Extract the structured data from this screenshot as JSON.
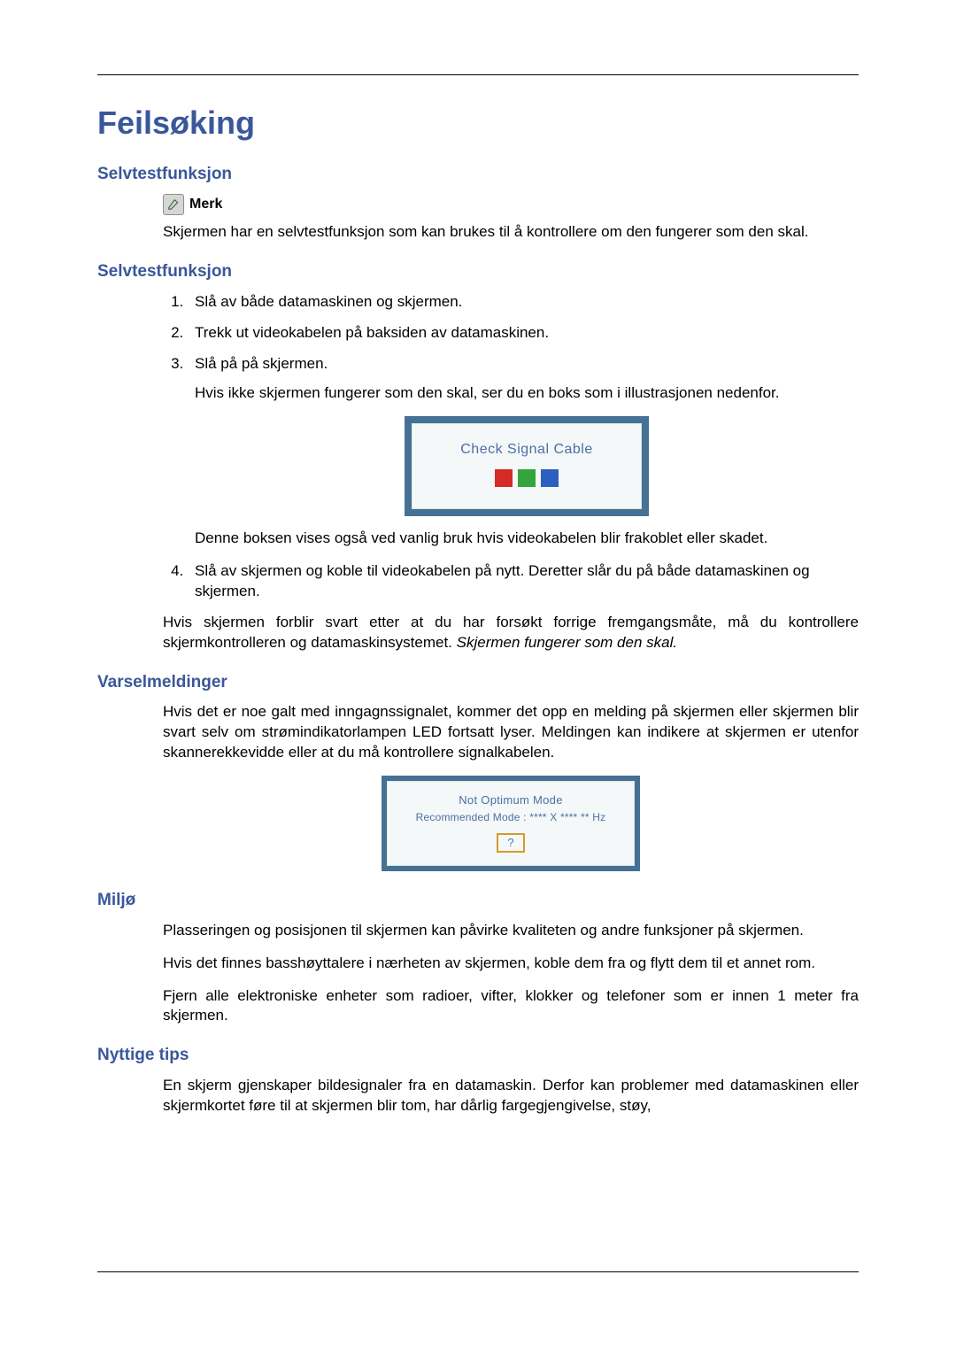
{
  "title": "Feilsøking",
  "sections": {
    "s1": {
      "heading": "Selvtestfunksjon",
      "note_label": "Merk",
      "para": "Skjermen har en selvtestfunksjon som kan brukes til å kontrollere om den fungerer som den skal."
    },
    "s2": {
      "heading": "Selvtestfunksjon",
      "steps": [
        "Slå av både datamaskinen og skjermen.",
        "Trekk ut videokabelen på baksiden av datamaskinen.",
        "Slå på på skjermen.",
        "Slå av skjermen og koble til videokabelen på nytt. Deretter slår du på både datamaskinen og skjermen."
      ],
      "step3_extra_before": "Hvis ikke skjermen fungerer som den skal, ser du en boks som i illustrasjonen nedenfor.",
      "step3_extra_after": "Denne boksen vises også ved vanlig bruk hvis videokabelen blir frakoblet eller skadet.",
      "osd_check_label": "Check Signal Cable",
      "closing_para": "Hvis skjermen forblir svart etter at du har forsøkt forrige fremgangsmåte, må du kontrollere skjermkontrolleren og datamaskinsystemet. ",
      "closing_italic": "Skjermen fungerer som den skal."
    },
    "s3": {
      "heading": "Varselmeldinger",
      "para": "Hvis det er noe galt med inngagnssignalet, kommer det opp en melding på skjermen eller skjermen blir svart selv om strømindikatorlampen LED fortsatt lyser. Meldingen kan indikere at skjermen er utenfor skannerekkevidde eller at du må kontrollere signalkabelen.",
      "osd_line1": "Not Optimum Mode",
      "osd_line2": "Recommended Mode : **** X **** ** Hz",
      "osd_q": "?"
    },
    "s4": {
      "heading": "Miljø",
      "p1": "Plasseringen og posisjonen til skjermen kan påvirke kvaliteten og andre funksjoner på skjermen.",
      "p2": "Hvis det finnes basshøyttalere i nærheten av skjermen, koble dem fra og flytt dem til et annet rom.",
      "p3": "Fjern alle elektroniske enheter som radioer, vifter, klokker og telefoner som er innen 1 meter fra skjermen."
    },
    "s5": {
      "heading": "Nyttige tips",
      "p1": "En skjerm gjenskaper bildesignaler fra en datamaskin. Derfor kan problemer med datamaskinen eller skjermkortet føre til at skjermen blir tom, har dårlig fargegjengivelse, støy,"
    }
  }
}
